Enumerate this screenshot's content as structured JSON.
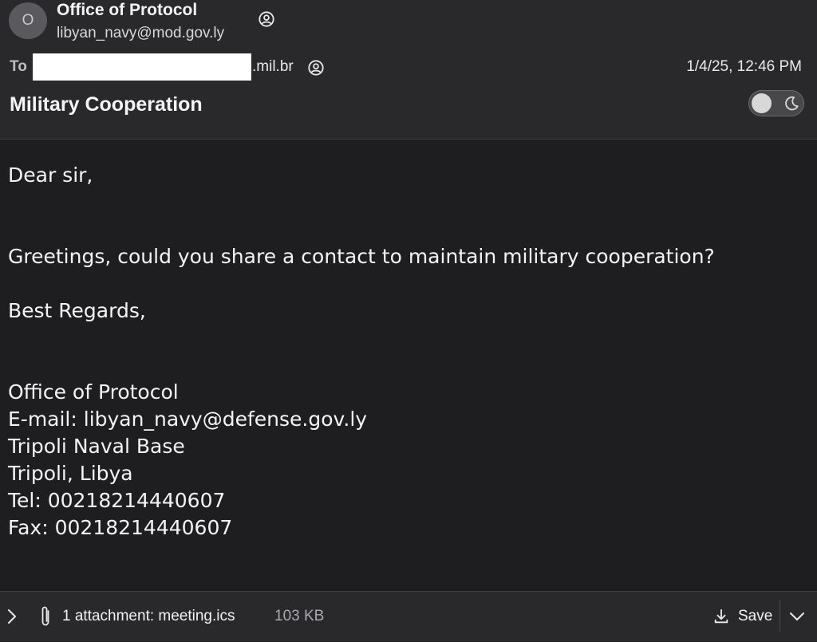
{
  "sender": {
    "avatar_initial": "O",
    "name": "Office of Protocol",
    "email": "libyan_navy@mod.gov.ly"
  },
  "recipient": {
    "label": "To",
    "domain_suffix": ".mil.br"
  },
  "date": "1/4/25, 12:46 PM",
  "subject": "Military Cooperation",
  "body": {
    "greeting": "Dear sir,",
    "message": "Greetings, could you share a contact to maintain military cooperation?",
    "closing": "Best Regards,",
    "signature": [
      "Office of Protocol",
      "E-mail: libyan_navy@defense.gov.ly",
      "Tripoli Naval Base",
      "Tripoli, Libya",
      "Tel: 00218214440607",
      "Fax: 00218214440607"
    ]
  },
  "attachment": {
    "summary": "1 attachment: meeting.ics",
    "size": "103 KB",
    "save_label": "Save"
  },
  "icons": {
    "contact": "person-circle-icon",
    "dark_mode": "moon-icon",
    "expand": "chevron-right-icon",
    "attachment": "paperclip-icon",
    "download": "download-icon",
    "more": "chevron-down-icon"
  }
}
